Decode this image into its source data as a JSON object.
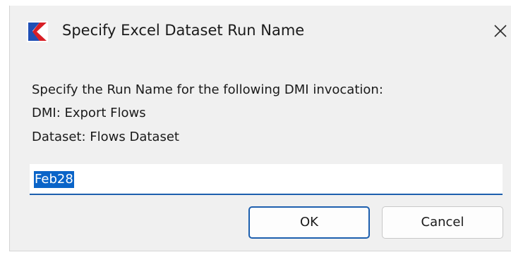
{
  "window": {
    "title": "Specify Excel Dataset Run Name",
    "app_icon": "riverware-logo-icon",
    "close_icon": "close-icon"
  },
  "message": {
    "line1": "Specify the Run Name for the following DMI invocation:",
    "line2": "DMI: Export Flows",
    "line3": "Dataset: Flows Dataset"
  },
  "input": {
    "value": "Feb28"
  },
  "buttons": {
    "ok_label": "OK",
    "cancel_label": "Cancel"
  },
  "colors": {
    "accent": "#1d5fae",
    "selection": "#0a64c8",
    "dialog_bg": "#f0f0f0"
  }
}
